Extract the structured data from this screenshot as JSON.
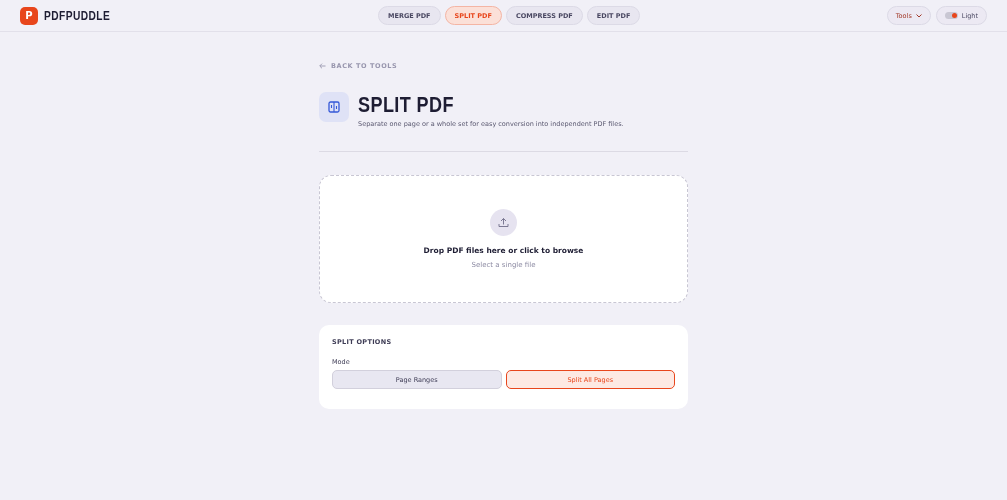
{
  "brand": {
    "logo_letter": "P",
    "name": "PDFPUDDLE"
  },
  "nav_tabs": [
    {
      "label": "MERGE PDF",
      "selected": false
    },
    {
      "label": "SPLIT PDF",
      "selected": true
    },
    {
      "label": "COMPRESS PDF",
      "selected": false
    },
    {
      "label": "EDIT PDF",
      "selected": false
    }
  ],
  "tools_menu": {
    "label": "Tools"
  },
  "theme_toggle": {
    "label": "Light",
    "on": true
  },
  "back_link": "BACK TO TOOLS",
  "title": "SPLIT PDF",
  "subtitle": "Separate one page or a whole set for easy conversion into independent PDF files.",
  "dropzone": {
    "title": "Drop PDF files here or click to browse",
    "hint": "Select a single file"
  },
  "options": {
    "heading": "SPLIT OPTIONS",
    "mode_label": "Mode",
    "modes": [
      {
        "label": "Page Ranges",
        "selected": false
      },
      {
        "label": "Split All Pages",
        "selected": true
      }
    ]
  }
}
